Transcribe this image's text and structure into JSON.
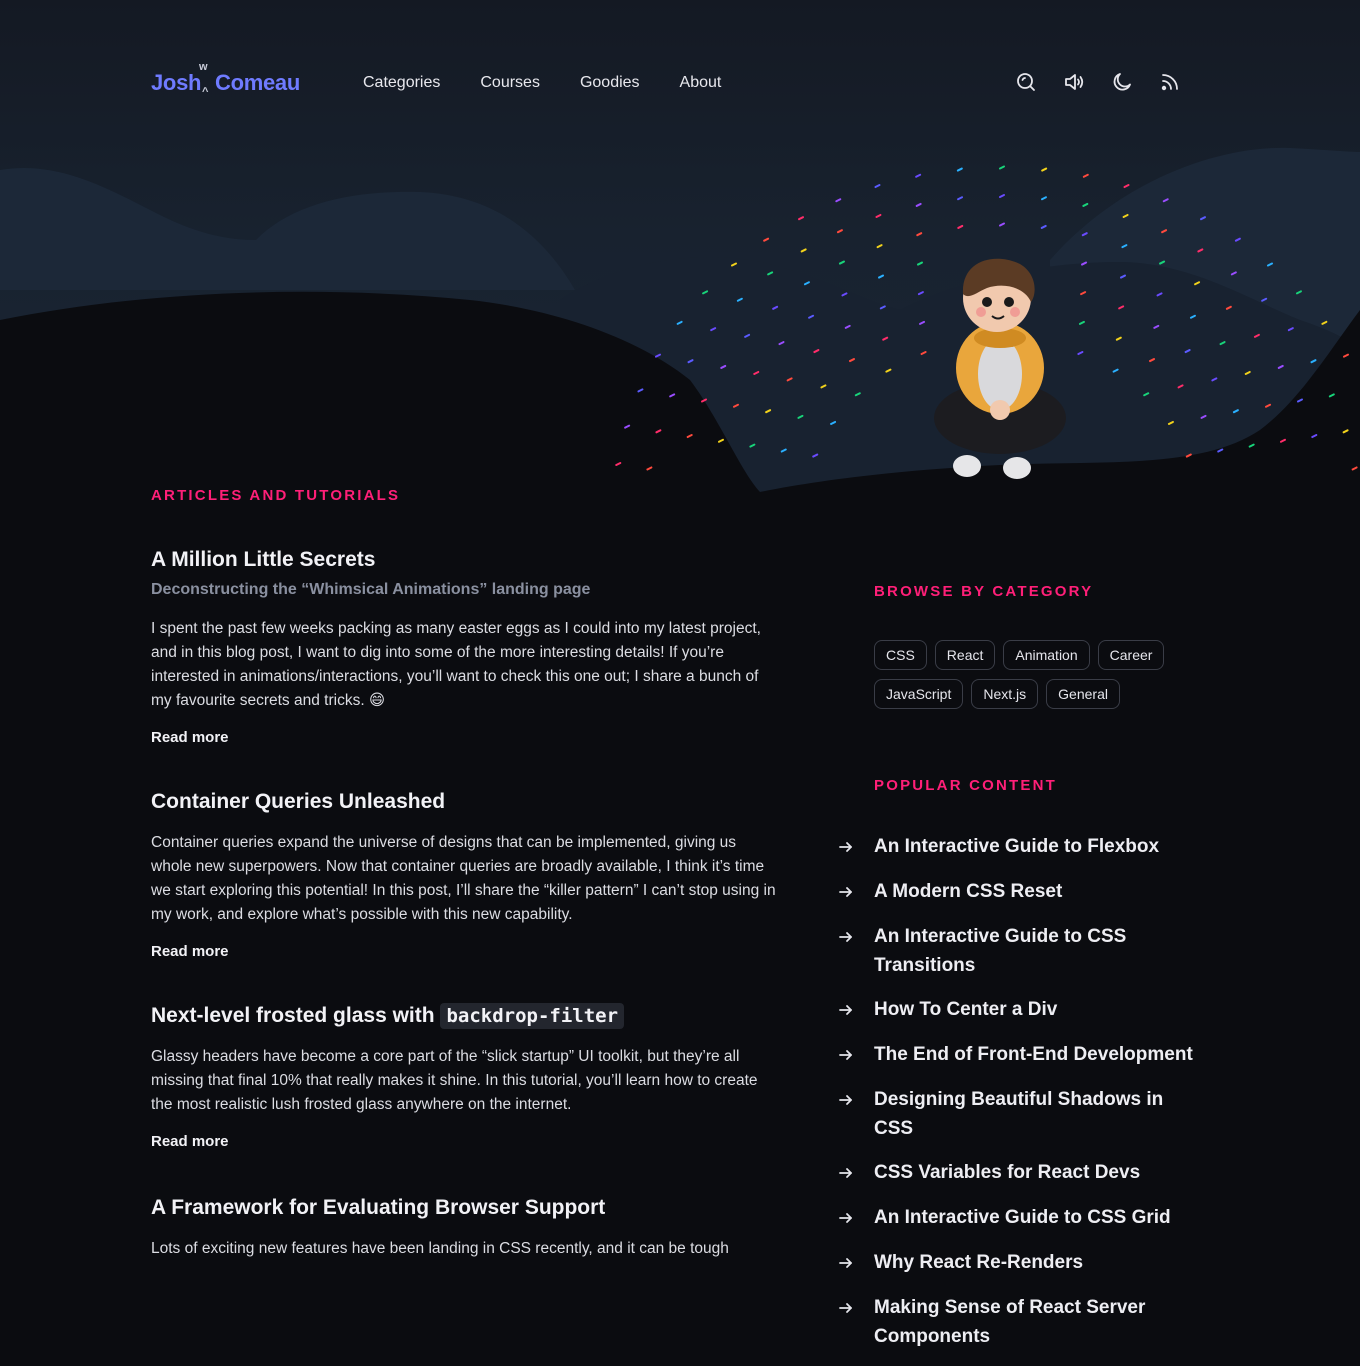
{
  "header": {
    "logo": {
      "first": "Josh",
      "last": "Comeau",
      "glyph_top": "w",
      "glyph_bottom": "^"
    },
    "nav": [
      {
        "label": "Categories"
      },
      {
        "label": "Courses"
      },
      {
        "label": "Goodies"
      },
      {
        "label": "About"
      }
    ],
    "tools": [
      "search-icon",
      "sound-on-icon",
      "moon-icon",
      "rss-icon"
    ]
  },
  "colors": {
    "accent": "#ff1f78",
    "logo": "#6f7bff",
    "background": "#0b0c10"
  },
  "articles_section": {
    "label": "Articles and Tutorials",
    "items": [
      {
        "title": "A Million Little Secrets",
        "subtitle": "Deconstructing the “Whimsical Animations” landing page",
        "excerpt": "I spent the past few weeks packing as many easter eggs as I could into my latest project, and in this blog post, I want to dig into some of the more interesting details! If you’re interested in animations/interactions, you’ll want to check this one out; I share a bunch of my favourite secrets and tricks. 😄",
        "read_more": "Read more"
      },
      {
        "title": "Container Queries Unleashed",
        "excerpt": "Container queries expand the universe of designs that can be implemented, giving us whole new superpowers. Now that container queries are broadly available, I think it’s time we start exploring this potential! In this post, I’ll share the “killer pattern” I can’t stop using in my work, and explore what’s possible with this new capability.",
        "read_more": "Read more"
      },
      {
        "title_prefix": "Next-level frosted glass with",
        "title_code": "backdrop-filter",
        "excerpt": "Glassy headers have become a core part of the “slick startup” UI toolkit, but they’re all missing that final 10% that really makes it shine. In this tutorial, you’ll learn how to create the most realistic lush frosted glass anywhere on the internet.",
        "read_more": "Read more"
      },
      {
        "title": "A Framework for Evaluating Browser Support",
        "excerpt": "Lots of exciting new features have been landing in CSS recently, and it can be tough"
      }
    ]
  },
  "sidebar": {
    "browse_label": "Browse by Category",
    "categories": [
      "CSS",
      "React",
      "Animation",
      "Career",
      "JavaScript",
      "Next.js",
      "General"
    ],
    "popular_label": "Popular Content",
    "popular": [
      "An Interactive Guide to Flexbox",
      "A Modern CSS Reset",
      "An Interactive Guide to CSS Transitions",
      "How To Center a Div",
      "The End of Front-End Development",
      "Designing Beautiful Shadows in CSS",
      "CSS Variables for React Devs",
      "An Interactive Guide to CSS Grid",
      "Why React Re-Renders",
      "Making Sense of React Server Components"
    ]
  }
}
